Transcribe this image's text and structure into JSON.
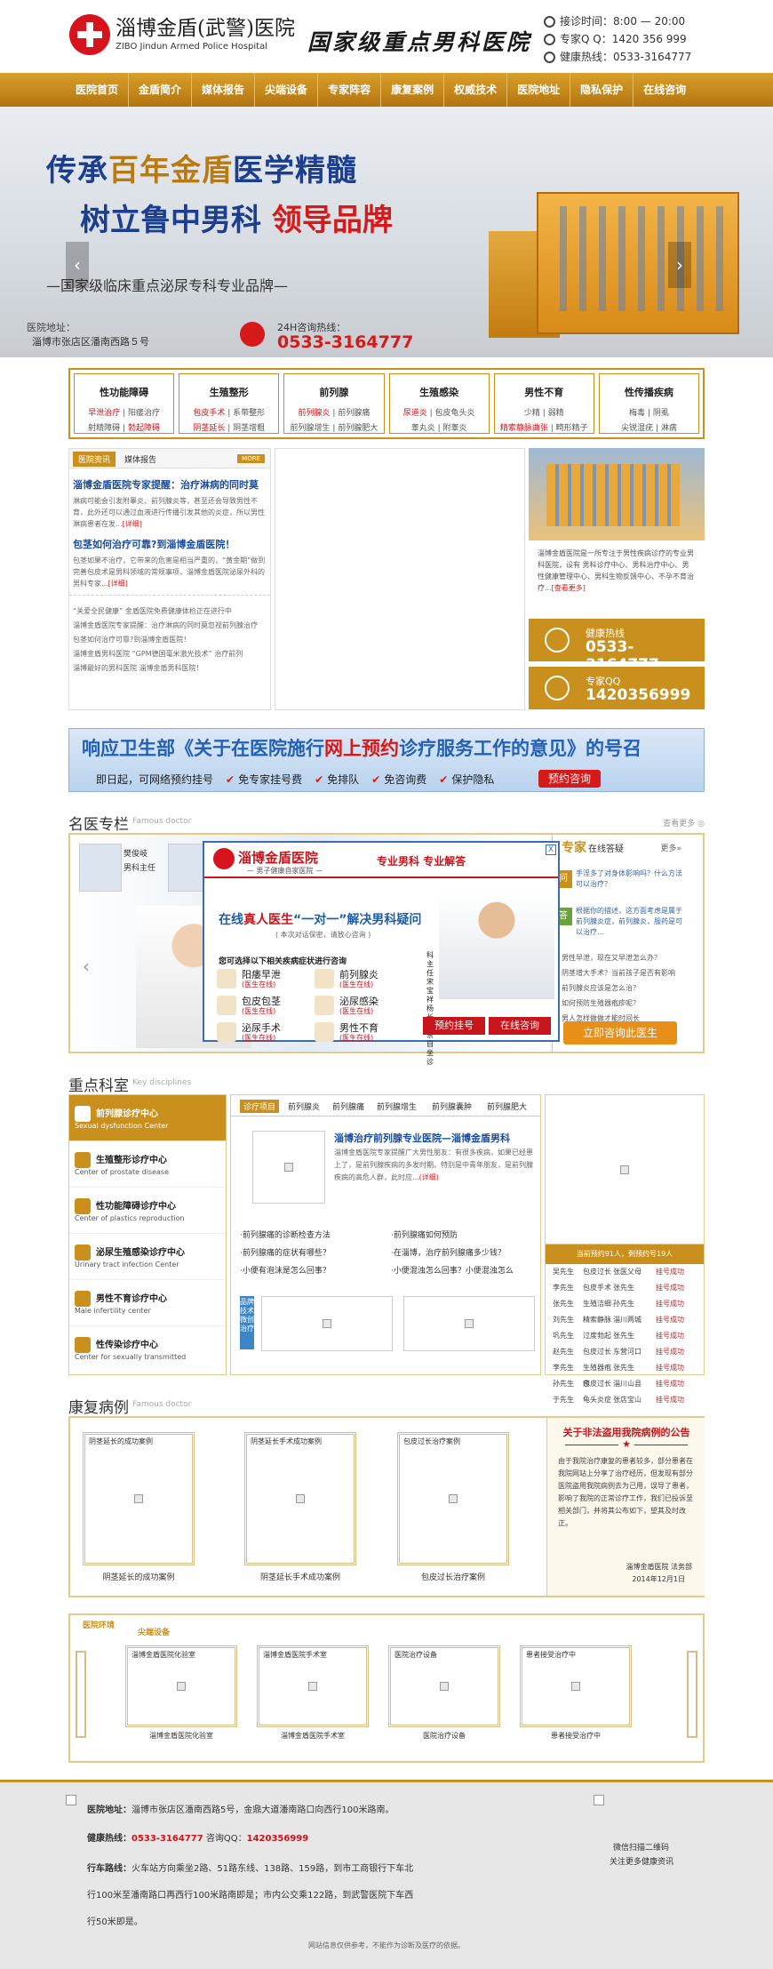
{
  "header": {
    "logo_cn": "淄博金盾(武警)医院",
    "logo_en": "ZIBO Jindun Armed Police Hospital",
    "slogan": "国家级重点男科医院",
    "hours": "接诊时间：8:00 — 20:00",
    "qq": "专家Q Q：1420 356 999",
    "hotline": "健康热线：0533-3164777"
  },
  "nav": [
    "医院首页",
    "金盾简介",
    "媒体报告",
    "尖端设备",
    "专家阵容",
    "康复案例",
    "权威技术",
    "医院地址",
    "隐私保护",
    "在线咨询"
  ],
  "banner": {
    "line1_a": "传承",
    "line1_b": "百年金盾",
    "line1_c": "医学精髓",
    "line2_a": "树立鲁中男科",
    "line2_b": "领导品牌",
    "sub": "—国家级临床重点泌尿专科专业品牌—",
    "addr_label": "医院地址：",
    "addr": "淄博市张店区潘南西路５号",
    "tel_label": "24H咨询热线：",
    "tel": "0533-3164777",
    "prev": "‹",
    "next": "›"
  },
  "categories": [
    {
      "title": "性功能障碍",
      "l1a": "早泄治疗",
      "l1b": "阳痿治疗",
      "l2a": "射精障碍",
      "l2b": "勃起障碍"
    },
    {
      "title": "生殖整形",
      "l1a": "包皮手术",
      "l1b": "系带整形",
      "l2a": "阴茎延长",
      "l2b": "阴茎增粗"
    },
    {
      "title": "前列腺",
      "l1a": "前列腺炎",
      "l1b": "前列腺痛",
      "l2a": "前列腺增生",
      "l2b": "前列腺肥大"
    },
    {
      "title": "生殖感染",
      "l1a": "尿道炎",
      "l1b": "包皮龟头炎",
      "l2a": "睾丸炎",
      "l2b": "附睾炎"
    },
    {
      "title": "男性不育",
      "l1a": "少精",
      "l1b": "弱精",
      "l2a": "精索静脉曲张",
      "l2b": "畸形精子"
    },
    {
      "title": "性传播疾病",
      "l1a": "梅毒",
      "l1b": "阴虱",
      "l2a": "尖锐湿疣",
      "l2b": "淋病"
    }
  ],
  "news": {
    "tab1": "医院资讯",
    "tab2": "媒体报告",
    "more": "MORE",
    "h1": "淄博金盾医院专家提醒：治疗淋病的同时莫",
    "p1": "淋病可能会引发附睾炎、前列腺炎等，甚至还会导致男性不育，此外还可以通过血液进行传播引发其他的炎症，所以男性淋病患者在发...",
    "p1_more": "[详细]",
    "h2": "包茎如何治疗可靠?到淄博金盾医院！",
    "p2": "包茎如果不治疗，它带来的危害是相当严重的，“黄金期”做到完善包皮术是男科领域的常规事项，淄博金盾医院泌尿外科的男科专家...",
    "p2_more": "[详细]",
    "list": [
      "“关爱全民健康” 金盾医院免费健康体检正在进行中",
      "淄博金盾医院专家提醒：治疗淋病的同时莫忽视前列腺治疗",
      "包茎如何治疗可靠?到淄博金盾医院！",
      "淄博金盾男科医院 “GPM德国毫米激光技术” 治疗前列",
      "淄博最好的男科医院 淄博金盾男科医院！"
    ],
    "hosp_desc": "淄博金盾医院是一所专注于男性疾病诊疗的专业男科医院，设有 男科诊疗中心、男科治疗中心、男性健康管理中心、男科生物反馈中心、不孕不育治疗...",
    "hosp_more": "[查看更多]",
    "box1_label": "健康热线",
    "box1_value": "0533-3164777",
    "box2_label": "专家QQ",
    "box2_value": "1420356999"
  },
  "ad": {
    "t_a": "响应卫生部《关于在医院施行",
    "t_b": "网上预约",
    "t_c": "诊疗服务工作的意见》的号召",
    "lead": "即日起，可网络预约挂号",
    "i1": "免专家挂号费",
    "i2": "免排队",
    "i3": "免咨询费",
    "i4": "保护隐私",
    "btn": "预约咨询",
    "ck": "✔"
  },
  "doctors": {
    "title": "名医专栏",
    "en": "Famous doctor",
    "more": "查看更多 ◎",
    "doc_name": "樊俊岐",
    "doc_title": "男科主任",
    "arrow": "‹",
    "zx_title": "专家",
    "zx_sub": "在线答疑",
    "zx_more": "更多»",
    "q1": "手淫多了对身体影响吗？什么方法可以治疗？",
    "q2": "根据你的描述，这方面考虑是属于前列腺炎症，前列腺炎，服药是可以治疗...",
    "q_icon": "问",
    "a_icon": "答",
    "qlist": [
      "男性早泄，现在又早泄怎么办？",
      "阴茎增大手术？当前孩子是否有影响",
      "前列腺炎应该是怎么治？",
      "如何预防生殖器疱疹呢？",
      "男人怎样做做才能时间长",
      "包皮过长会不会影响生育"
    ],
    "btn": "立即咨询此医生"
  },
  "popup": {
    "close": "X",
    "name": "淄博金盾医院",
    "sub": "— 男子健康自家医院 —",
    "tag": "专业男科  专业解答",
    "line_a": "在线",
    "line_b": "真人医生",
    "line_c": "“一对一”解决男科疑问",
    "note": "( 本次对话保密，请放心咨询 )",
    "q": "您可选择以下相关疾病症状进行咨询",
    "items": [
      {
        "n": "阳痿早泄",
        "s": "(医生在线)"
      },
      {
        "n": "前列腺炎",
        "s": "(医生在线)"
      },
      {
        "n": "包皮包茎",
        "s": "(医生在线)"
      },
      {
        "n": "泌尿感染",
        "s": "(医生在线)"
      },
      {
        "n": "泌尿手术",
        "s": "(医生在线)"
      },
      {
        "n": "男性不育",
        "s": "(医生在线)"
      }
    ],
    "vt": "科主任宋宝祥 杨长乐亲自坐诊",
    "b1": "预约挂号",
    "b2": "在线咨询"
  },
  "depts": {
    "title": "重点科室",
    "en": "Key disciplines",
    "items": [
      {
        "n": "前列腺诊疗中心",
        "e": "Sexual dysfunction Center"
      },
      {
        "n": "生殖整形诊疗中心",
        "e": "Center of prostate disease"
      },
      {
        "n": "性功能障碍诊疗中心",
        "e": "Center of plastics reproduction"
      },
      {
        "n": "泌尿生殖感染诊疗中心",
        "e": "Urinary tract infection Center"
      },
      {
        "n": "男性不育诊疗中心",
        "e": "Male infertility center"
      },
      {
        "n": "性传染诊疗中心",
        "e": "Center for sexually transmitted"
      }
    ],
    "tabs": [
      "诊疗项目",
      "前列腺炎",
      "前列腺痛",
      "前列腺增生",
      "前列腺囊肿",
      "前列腺肥大"
    ],
    "h": "淄博治疗前列腺专业医院—淄博金盾男科",
    "p": "淄博金盾医院专家提醒广大男性朋友：有很多疾病，如果已经患上了，是前列腺疾病的多发时期。特别是中青年朋友，是前列腺疾病的高危人群，此时应...",
    "p_more": "(详细)",
    "links": [
      "·前列腺痛的诊断检查方法",
      "·前列腺痛如何预防",
      "·前列腺痛的症状有哪些？",
      "·在淄博，治疗前列腺痛多少钱？",
      "·小便有泡沫是怎么回事？",
      "·小便混浊怎么回事？小便混浊怎么"
    ],
    "vbar": "品牌技术 微创治疗",
    "count": "当前预约91人，剩预约号19人",
    "rows": [
      [
        "吴先生",
        "包皮过长",
        "张医父母",
        "挂号成功"
      ],
      [
        "李先生",
        "包皮手术",
        "张先生",
        "挂号成功"
      ],
      [
        "张先生",
        "生殖洁细",
        "孙先生",
        "挂号成功"
      ],
      [
        "刘先生",
        "精索静脉",
        "淄川两城",
        "挂号成功"
      ],
      [
        "巩先生",
        "过度勃起",
        "张先生",
        "挂号成功"
      ],
      [
        "赵先生",
        "包皮过长",
        "东营河口",
        "挂号成功"
      ],
      [
        "李先生",
        "生殖器疱疹",
        "张先生",
        "挂号成功"
      ],
      [
        "孙先生",
        "包皮过长",
        "淄川山县",
        "挂号成功"
      ],
      [
        "于先生",
        "龟头炎症",
        "张店宝山",
        "挂号成功"
      ]
    ]
  },
  "recovery": {
    "title": "康复病例",
    "en": "Famous doctor",
    "cards": [
      {
        "t": "阴茎延长的成功案例",
        "cap": "阴茎延长的成功案例"
      },
      {
        "t": "阴茎延长手术成功案例",
        "cap": "阴茎延长手术成功案例"
      },
      {
        "t": "包皮过长治疗案例",
        "cap": "包皮过长治疗案例"
      }
    ],
    "notice_title": "关于非法盗用我院病例的公告",
    "star": "★",
    "notice": "由于我院治疗康复的患者较多，部分患者在我院网站上分享了治疗经历，但发现有部分医院盗用我院病例去为己用，误导了患者，影响了我院的正常诊疗工作，我们已投诉至相关部门，并将其公布如下，望其及时改正。",
    "sig1": "淄博金盾医院 法务部",
    "sig2": "2014年12月1日"
  },
  "env": {
    "tab1": "医院环境",
    "tab2": "尖端设备",
    "cards": [
      {
        "t": "淄博金盾医院化验室",
        "cap": "淄博金盾医院化验室"
      },
      {
        "t": "淄博金盾医院手术室",
        "cap": "淄博金盾医院手术室"
      },
      {
        "t": "医院治疗设备",
        "cap": "医院治疗设备"
      },
      {
        "t": "患者接受治疗中",
        "cap": "患者接受治疗中"
      }
    ]
  },
  "footer": {
    "addr_b": "医院地址：",
    "addr": "淄博市张店区潘南西路5号，金鼎大道潘南路口向西行100米路南。",
    "tel_b": "健康热线：",
    "tel": "0533-3164777",
    "qq_l": "咨询QQ：",
    "qq": "1420356999",
    "route_b": "行车路线：",
    "route1": "火车站方向乘坐2路、51路东线、138路、159路，到市工商银行下车北",
    "route2": "行100米至潘南路口再西行100米路南即是；市内公交乘122路，到武警医院下车西",
    "route3": "行50米即是。",
    "qr1": "微信扫描二维码",
    "qr2": "关注更多健康资讯",
    "copy": "网站信息仅供参考，不能作为诊断及医疗的依据。"
  }
}
